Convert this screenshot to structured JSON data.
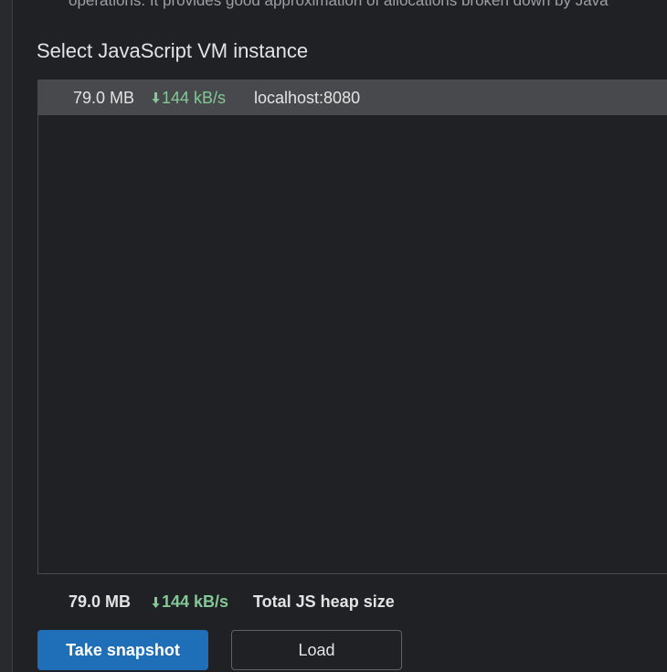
{
  "description_fragment": "operations. It provides good approximation of allocations broken down by Java",
  "section_title": "Select JavaScript VM instance",
  "vm_instances": [
    {
      "memory": "79.0 MB",
      "rate": "144 kB/s",
      "host": "localhost:8080",
      "selected": true
    }
  ],
  "summary": {
    "memory": "79.0 MB",
    "rate": "144 kB/s",
    "label": "Total JS heap size"
  },
  "buttons": {
    "take_snapshot": "Take snapshot",
    "load": "Load"
  },
  "colors": {
    "accent": "#1f6fb8",
    "rate_green": "#81c995",
    "selected_row": "#48494c",
    "background": "#202124"
  },
  "icons": {
    "rate_indicator": "down-arrow-icon"
  }
}
